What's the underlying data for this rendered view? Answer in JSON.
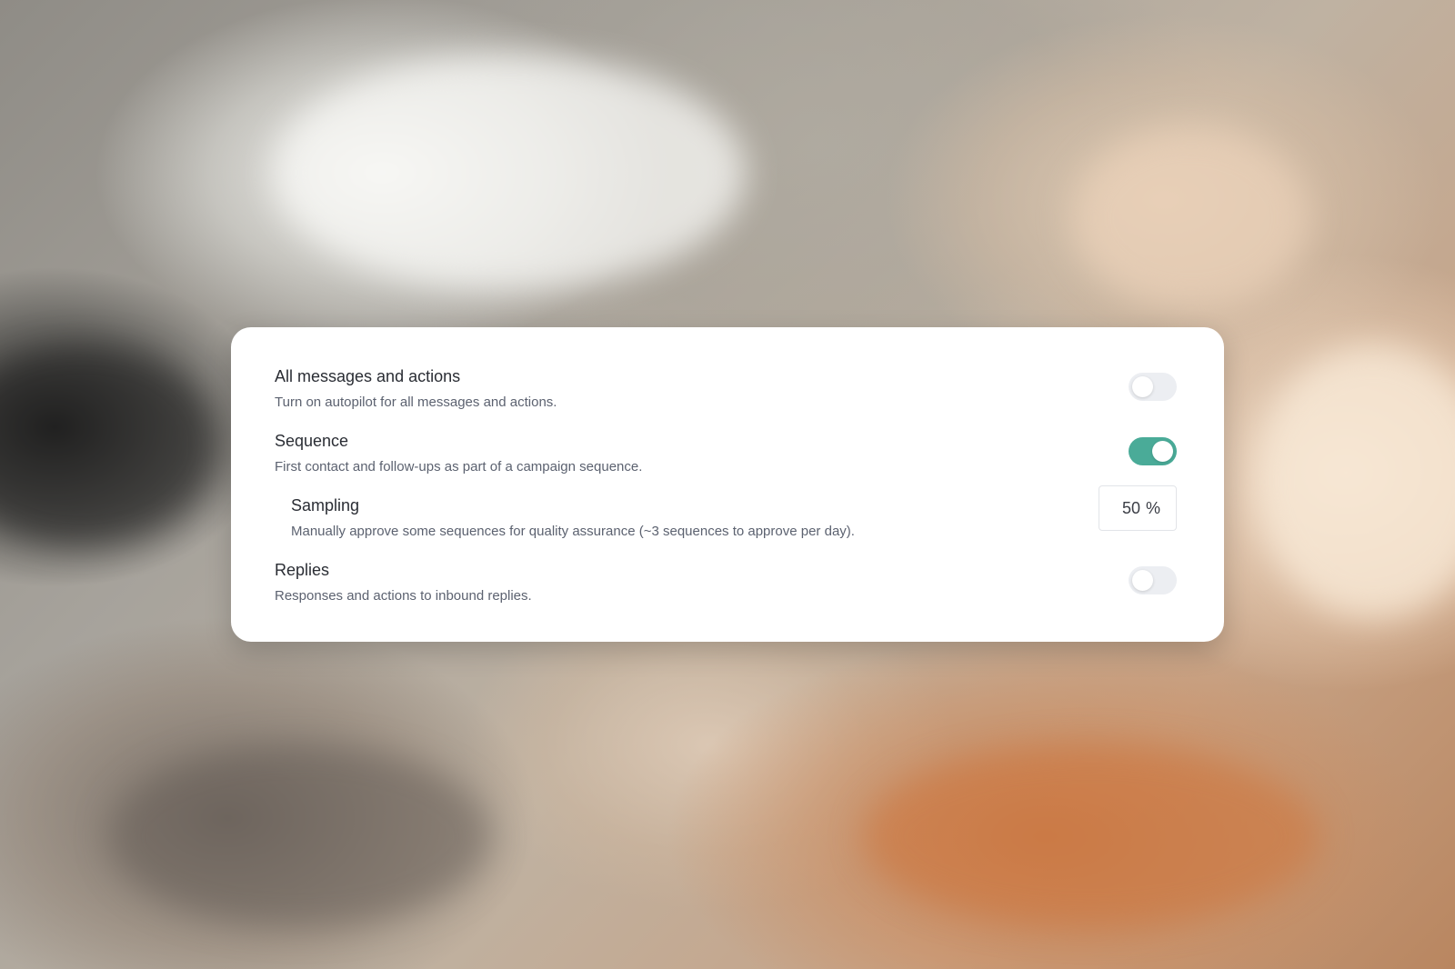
{
  "settings": {
    "items": [
      {
        "title": "All messages and actions",
        "description": "Turn on autopilot for all messages and actions.",
        "enabled": false
      },
      {
        "title": "Sequence",
        "description": "First contact and follow-ups as part of a campaign sequence.",
        "enabled": true
      },
      {
        "title": "Sampling",
        "description": "Manually approve some sequences for quality assurance (~3 sequences to approve per day).",
        "value": "50",
        "unit": "%"
      },
      {
        "title": "Replies",
        "description": "Responses and actions to inbound replies.",
        "enabled": false
      }
    ]
  },
  "colors": {
    "toggle_on": "#4aab98",
    "toggle_off": "#eceef2"
  }
}
